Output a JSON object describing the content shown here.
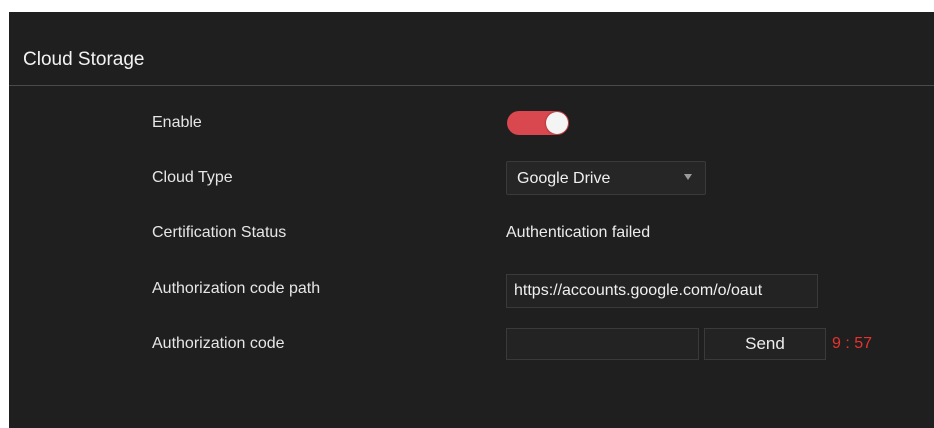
{
  "colors": {
    "accent": "#d9474f",
    "countdown": "#e8322f",
    "panel_background": "#1f1f1f"
  },
  "header": {
    "title": "Cloud Storage"
  },
  "form": {
    "enable": {
      "label": "Enable",
      "value": true
    },
    "cloud_type": {
      "label": "Cloud Type",
      "selected": "Google Drive"
    },
    "certification_status": {
      "label": "Certification Status",
      "value": "Authentication failed"
    },
    "authorization_code_path": {
      "label": "Authorization code path",
      "value": "https://accounts.google.com/o/oaut"
    },
    "authorization_code": {
      "label": "Authorization code",
      "value": "",
      "send_label": "Send",
      "countdown": "9 : 57"
    }
  }
}
